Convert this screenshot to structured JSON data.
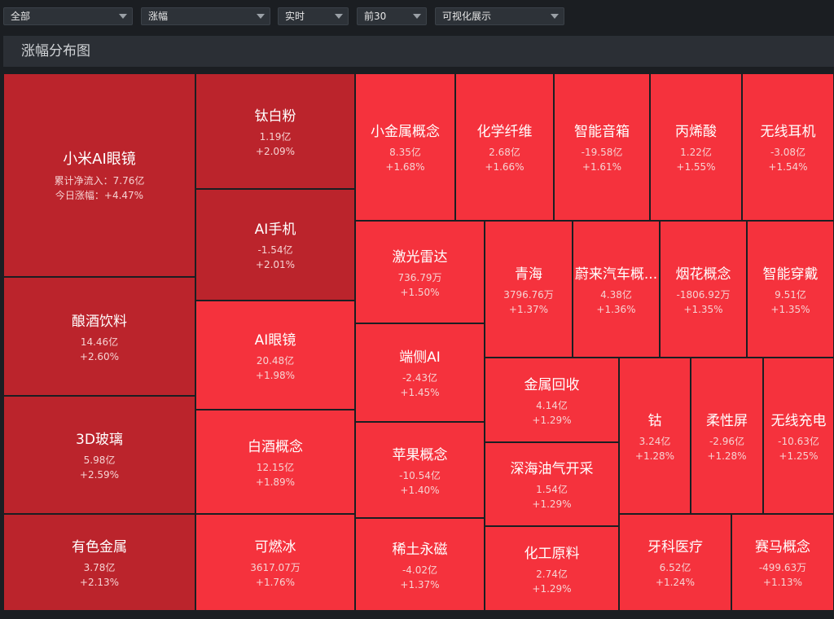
{
  "toolbar": {
    "filters": [
      {
        "label": "全部"
      },
      {
        "label": "涨幅"
      },
      {
        "label": "实时"
      },
      {
        "label": "前30"
      },
      {
        "label": "可视化展示"
      }
    ]
  },
  "title": "涨幅分布图",
  "colors": {
    "dark": "#bb242c",
    "bright": "#f5323d",
    "border": "#1b1e22"
  },
  "chart_data": {
    "type": "treemap",
    "items": [
      {
        "name": "小米AI眼镜",
        "flow_label": "累计净流入：",
        "flow": "7.76亿",
        "change_label": "今日涨幅：",
        "change": "+4.47%"
      },
      {
        "name": "钛白粉",
        "flow": "1.19亿",
        "change": "+2.09%"
      },
      {
        "name": "AI手机",
        "flow": "-1.54亿",
        "change": "+2.01%"
      },
      {
        "name": "酿酒饮料",
        "flow": "14.46亿",
        "change": "+2.60%"
      },
      {
        "name": "3D玻璃",
        "flow": "5.98亿",
        "change": "+2.59%"
      },
      {
        "name": "有色金属",
        "flow": "3.78亿",
        "change": "+2.13%"
      },
      {
        "name": "AI眼镜",
        "flow": "20.48亿",
        "change": "+1.98%"
      },
      {
        "name": "白酒概念",
        "flow": "12.15亿",
        "change": "+1.89%"
      },
      {
        "name": "可燃冰",
        "flow": "3617.07万",
        "change": "+1.76%"
      },
      {
        "name": "小金属概念",
        "flow": "8.35亿",
        "change": "+1.68%"
      },
      {
        "name": "化学纤维",
        "flow": "2.68亿",
        "change": "+1.66%"
      },
      {
        "name": "智能音箱",
        "flow": "-19.58亿",
        "change": "+1.61%"
      },
      {
        "name": "丙烯酸",
        "flow": "1.22亿",
        "change": "+1.55%"
      },
      {
        "name": "无线耳机",
        "flow": "-3.08亿",
        "change": "+1.54%"
      },
      {
        "name": "激光雷达",
        "flow": "736.79万",
        "change": "+1.50%"
      },
      {
        "name": "青海",
        "flow": "3796.76万",
        "change": "+1.37%"
      },
      {
        "name": "蔚来汽车概...",
        "flow": "4.38亿",
        "change": "+1.36%"
      },
      {
        "name": "烟花概念",
        "flow": "-1806.92万",
        "change": "+1.35%"
      },
      {
        "name": "智能穿戴",
        "flow": "9.51亿",
        "change": "+1.35%"
      },
      {
        "name": "端侧AI",
        "flow": "-2.43亿",
        "change": "+1.45%"
      },
      {
        "name": "金属回收",
        "flow": "4.14亿",
        "change": "+1.29%"
      },
      {
        "name": "钴",
        "flow": "3.24亿",
        "change": "+1.28%"
      },
      {
        "name": "柔性屏",
        "flow": "-2.96亿",
        "change": "+1.28%"
      },
      {
        "name": "无线充电",
        "flow": "-10.63亿",
        "change": "+1.25%"
      },
      {
        "name": "苹果概念",
        "flow": "-10.54亿",
        "change": "+1.40%"
      },
      {
        "name": "深海油气开采",
        "flow": "1.54亿",
        "change": "+1.29%"
      },
      {
        "name": "稀土永磁",
        "flow": "-4.02亿",
        "change": "+1.37%"
      },
      {
        "name": "化工原料",
        "flow": "2.74亿",
        "change": "+1.29%"
      },
      {
        "name": "牙科医疗",
        "flow": "6.52亿",
        "change": "+1.24%"
      },
      {
        "name": "赛马概念",
        "flow": "-499.63万",
        "change": "+1.13%"
      }
    ]
  }
}
